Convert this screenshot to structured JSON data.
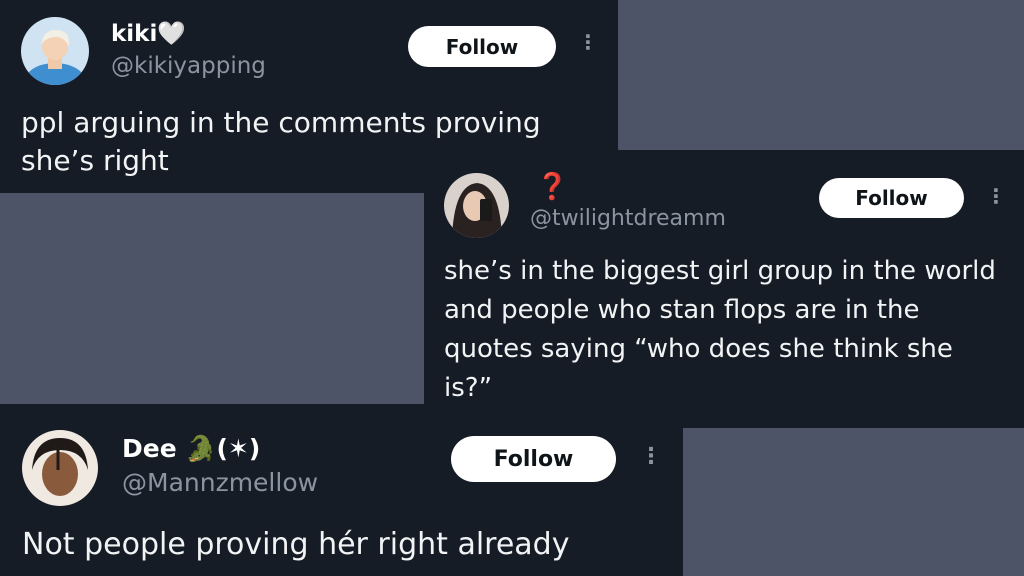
{
  "tweets": [
    {
      "name": "kiki🤍",
      "handle": "@kikiyapping",
      "follow_label": "Follow",
      "more_icon": "⋮",
      "text": "ppl arguing in the comments proving she’s right"
    },
    {
      "name": "❓",
      "handle": "@twilightdreamm",
      "follow_label": "Follow",
      "more_icon": "⋮",
      "text": "she’s in the biggest girl group in the world and people who stan flops are in the quotes saying “who does she think she is?”"
    },
    {
      "name": "Dee 🐊(✶)",
      "handle": "@Mannzmellow",
      "follow_label": "Follow",
      "more_icon": "⋮",
      "text": "Not people proving hér right already"
    }
  ],
  "colors": {
    "background": "#4e5468",
    "card": "#161c26",
    "handle": "#8b95a1",
    "follow_bg": "#ffffff"
  }
}
